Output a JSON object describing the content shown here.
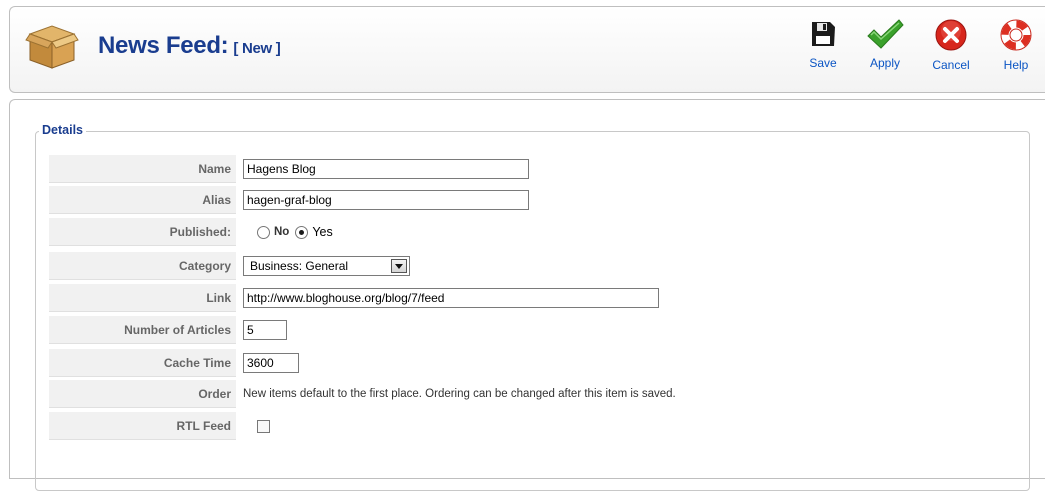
{
  "header": {
    "title": "News Feed:",
    "subtitle": "[ New ]",
    "icon": "package-box-icon"
  },
  "toolbar": {
    "buttons": [
      {
        "label": "Save",
        "icon": "floppy-disk-icon"
      },
      {
        "label": "Apply",
        "icon": "checkmark-icon"
      },
      {
        "label": "Cancel",
        "icon": "cancel-x-icon"
      },
      {
        "label": "Help",
        "icon": "lifebuoy-icon"
      }
    ]
  },
  "details": {
    "legend": "Details",
    "name": {
      "label": "Name",
      "value": "Hagens Blog"
    },
    "alias": {
      "label": "Alias",
      "value": "hagen-graf-blog"
    },
    "published": {
      "label": "Published:",
      "options": [
        "No",
        "Yes"
      ],
      "selected": "Yes"
    },
    "category": {
      "label": "Category",
      "value": "Business: General"
    },
    "link": {
      "label": "Link",
      "value": "http://www.bloghouse.org/blog/7/feed"
    },
    "num_articles": {
      "label": "Number of Articles",
      "value": "5"
    },
    "cache_time": {
      "label": "Cache Time",
      "value": "3600"
    },
    "order": {
      "label": "Order",
      "text": "New items default to the first place. Ordering can be changed after this item is saved."
    },
    "rtl_feed": {
      "label": "RTL Feed",
      "checked": false
    }
  },
  "colors": {
    "title": "#1a3d8f",
    "toolbar_label": "#0b55c4",
    "label_cell_bg": "#f1f1f1",
    "apply_green": "#3aa12b",
    "cancel_red": "#d7261c"
  }
}
